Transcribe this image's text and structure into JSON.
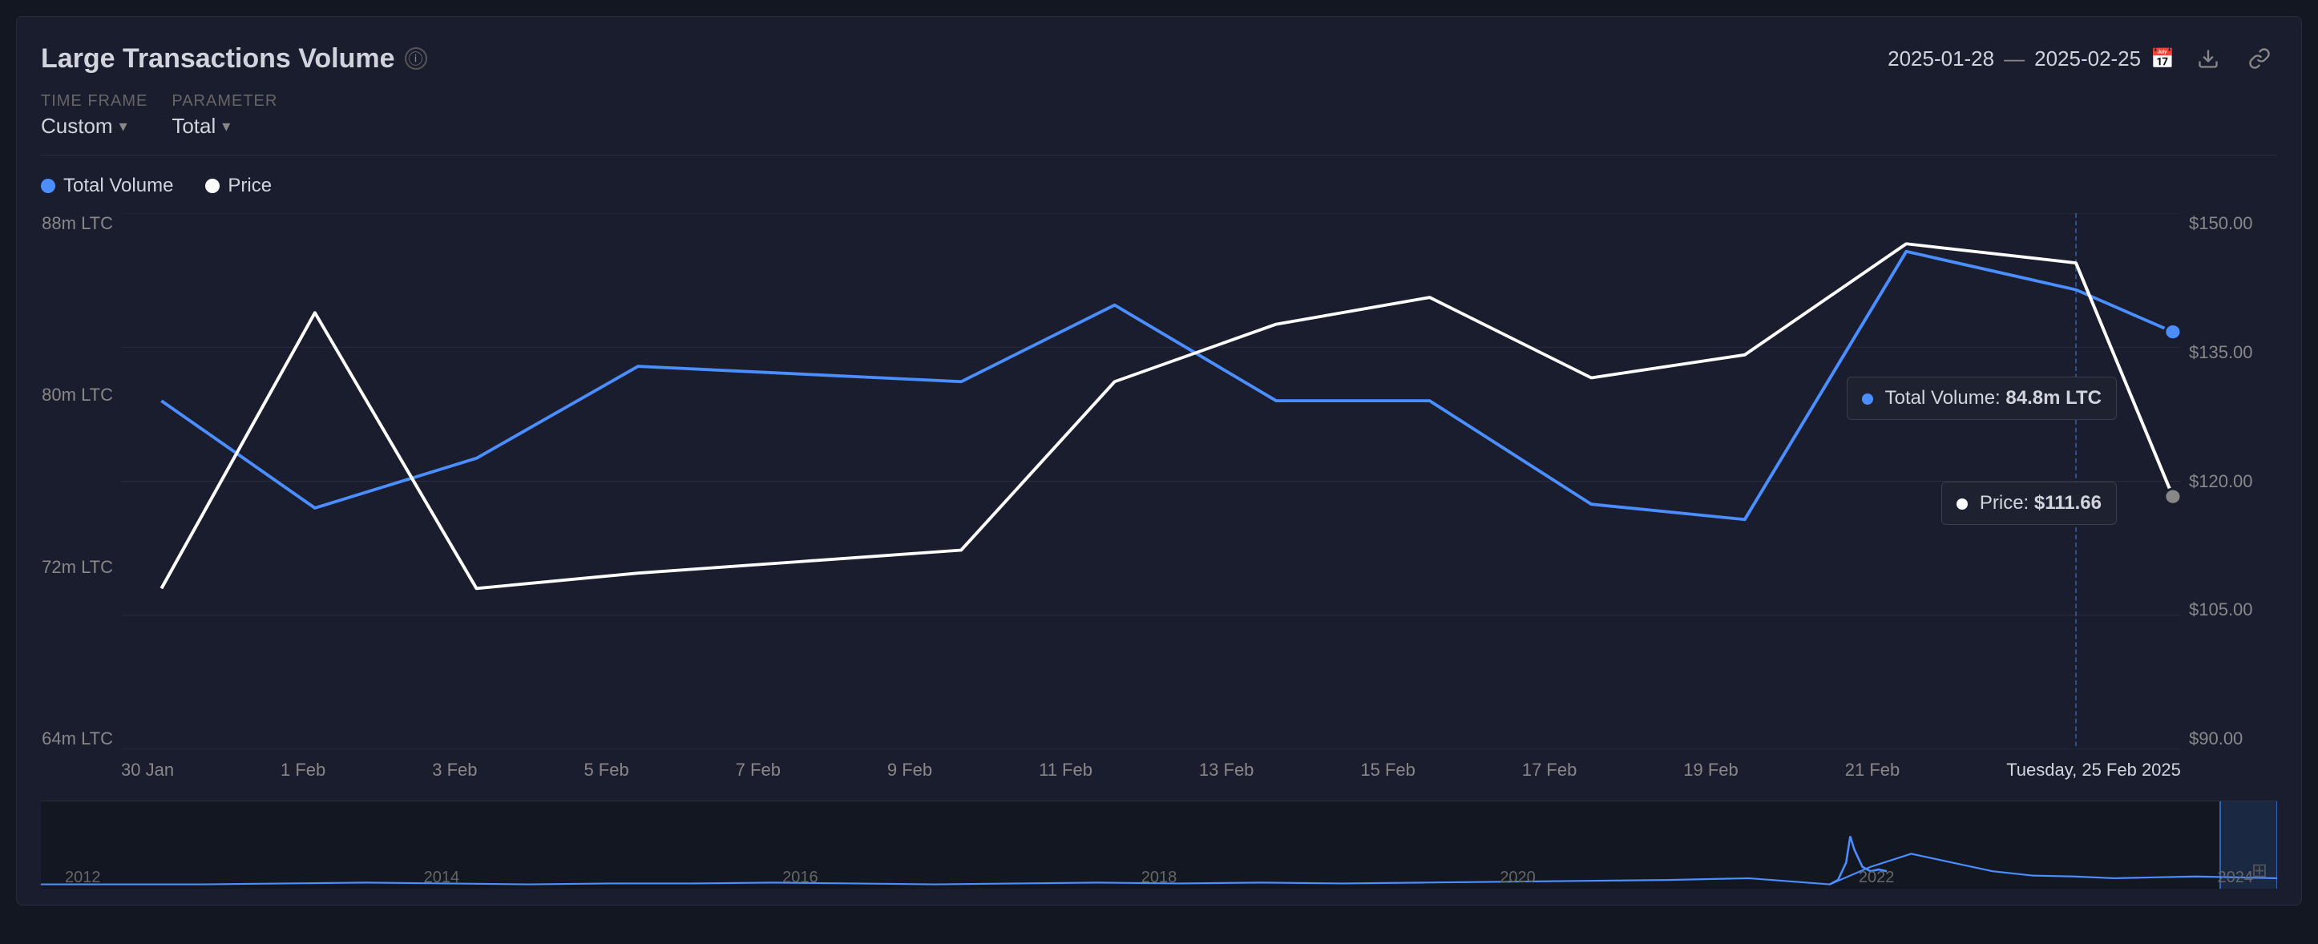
{
  "header": {
    "title": "Large Transactions Volume",
    "info_label": "i",
    "date_start": "2025-01-28",
    "date_separator": "—",
    "date_end": "2025-02-25",
    "download_icon": "⬇",
    "link_icon": "🔗"
  },
  "controls": {
    "timeframe_label": "TIME FRAME",
    "timeframe_value": "Custom",
    "parameter_label": "PARAMETER",
    "parameter_value": "Total"
  },
  "legend": {
    "items": [
      {
        "label": "Total Volume",
        "color": "blue"
      },
      {
        "label": "Price",
        "color": "white"
      }
    ]
  },
  "y_axis_left": {
    "labels": [
      "88m LTC",
      "80m LTC",
      "72m LTC",
      "64m LTC"
    ]
  },
  "y_axis_right": {
    "labels": [
      "$150.00",
      "$135.00",
      "$120.00",
      "$105.00",
      "$90.00"
    ]
  },
  "x_axis": {
    "labels": [
      "30 Jan",
      "1 Feb",
      "3 Feb",
      "5 Feb",
      "7 Feb",
      "9 Feb",
      "11 Feb",
      "13 Feb",
      "15 Feb",
      "17 Feb",
      "19 Feb",
      "21 Feb"
    ],
    "highlight_date": "Tuesday, 25 Feb 2025"
  },
  "tooltips": {
    "volume": {
      "label": "Total Volume:",
      "value": "84.8m LTC"
    },
    "price": {
      "label": "Price:",
      "value": "$111.66"
    }
  },
  "mini_chart": {
    "x_labels": [
      "2012",
      "2014",
      "2016",
      "2018",
      "2020",
      "2022",
      "2024"
    ]
  }
}
